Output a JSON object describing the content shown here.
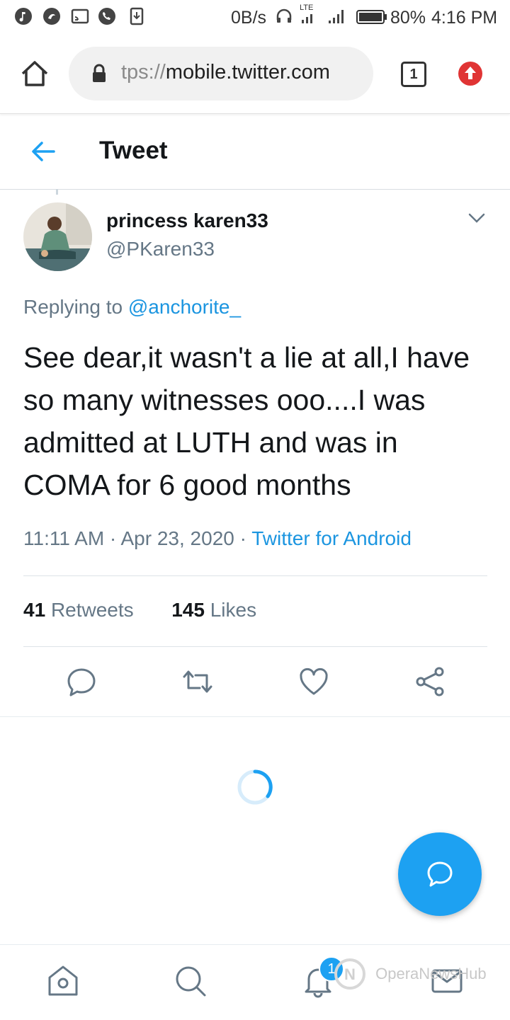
{
  "status_bar": {
    "net_speed": "0B/s",
    "lte_label": "LTE",
    "battery": "80%",
    "time": "4:16 PM",
    "icons": [
      "music-icon",
      "app-icon",
      "cast-icon",
      "phone-icon",
      "download-icon",
      "headphones-icon",
      "signal-icon",
      "battery-icon"
    ]
  },
  "browser": {
    "url_prefix": "tps://",
    "url_domain": "mobile.twitter.com",
    "tab_count": "1"
  },
  "header": {
    "title": "Tweet"
  },
  "tweet": {
    "display_name": "princess karen33",
    "handle": "@PKaren33",
    "replying_prefix": "Replying to ",
    "replying_to": "@anchorite_",
    "text": "See dear,it wasn't a lie at all,I have so many witnesses ooo....I was admitted at LUTH and was in COMA for 6 good months",
    "time": "11:11 AM",
    "date": "Apr 23, 2020",
    "separator": " · ",
    "source": "Twitter for Android",
    "retweets_count": "41",
    "retweets_label": "Retweets",
    "likes_count": "145",
    "likes_label": "Likes"
  },
  "bottom_nav": {
    "notification_badge": "1"
  },
  "watermark": {
    "text": "OperaNewsHub"
  },
  "colors": {
    "accent": "#1da1f2",
    "link": "#1b95e0",
    "muted": "#657786",
    "text": "#14171a"
  }
}
